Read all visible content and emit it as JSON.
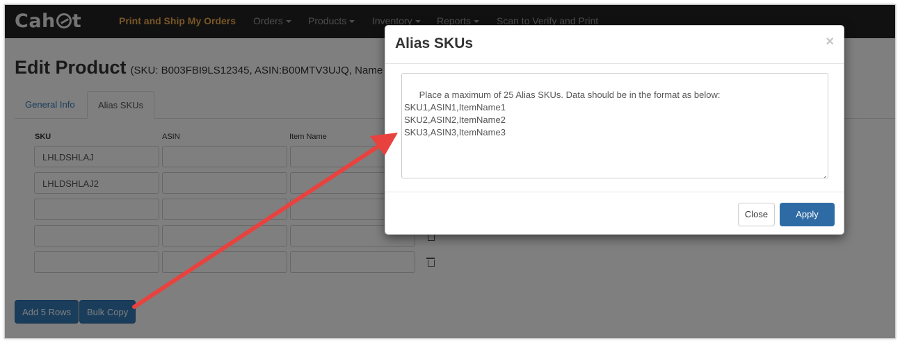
{
  "navbar": {
    "logo": "Cahoot",
    "items": [
      {
        "label": "Print and Ship My Orders",
        "active": true
      },
      {
        "label": "Orders",
        "dropdown": true
      },
      {
        "label": "Products",
        "dropdown": true
      },
      {
        "label": "Inventory",
        "dropdown": true
      },
      {
        "label": "Reports",
        "dropdown": true
      },
      {
        "label": "Scan to Verify and Print"
      }
    ]
  },
  "page": {
    "title": "Edit Product",
    "subtitle": "(SKU: B003FBI9LS12345, ASIN:B00MTV3UJQ, Name"
  },
  "tabs": [
    {
      "label": "General Info"
    },
    {
      "label": "Alias SKUs",
      "active": true
    }
  ],
  "table": {
    "headers": [
      "SKU",
      "ASIN",
      "Item Name"
    ],
    "rows": [
      {
        "sku": "LHLDSHLAJ",
        "asin": "",
        "item_name": ""
      },
      {
        "sku": "LHLDSHLAJ2",
        "asin": "",
        "item_name": ""
      },
      {
        "sku": "",
        "asin": "",
        "item_name": ""
      },
      {
        "sku": "",
        "asin": "",
        "item_name": ""
      },
      {
        "sku": "",
        "asin": "",
        "item_name": ""
      }
    ]
  },
  "actions": {
    "add_rows": "Add 5 Rows",
    "bulk_copy": "Bulk Copy"
  },
  "modal": {
    "title": "Alias SKUs",
    "close_icon": "×",
    "textarea_placeholder": "Place a maximum of 25 Alias SKUs. Data should be in the format as below:\nSKU1,ASIN1,ItemName1\nSKU2,ASIN2,ItemName2\nSKU3,ASIN3,ItemName3",
    "close_button": "Close",
    "apply_button": "Apply"
  },
  "colors": {
    "navbar_bg": "#222222",
    "nav_active": "#f0ad4e",
    "primary": "#337ab7",
    "annotation_arrow": "#e8423f"
  }
}
